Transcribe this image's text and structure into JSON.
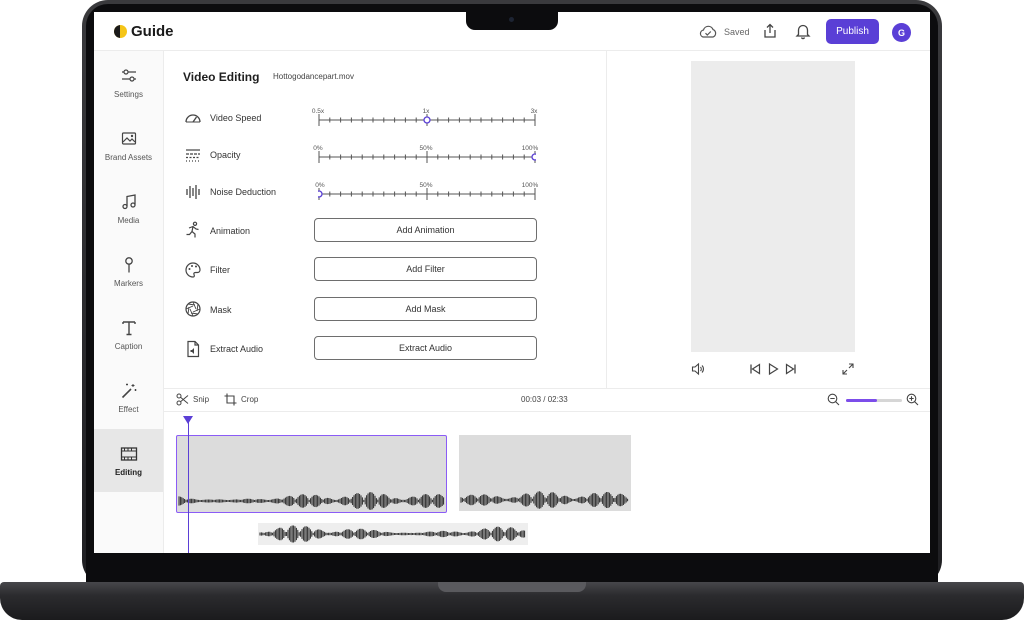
{
  "app": {
    "name": "Guide"
  },
  "header": {
    "saved_label": "Saved",
    "publish_label": "Publish",
    "avatar_initial": "G",
    "accent_color": "#5a3fd6"
  },
  "sidebar": {
    "items": [
      {
        "label": "Settings",
        "icon": "sliders-icon"
      },
      {
        "label": "Brand Assets",
        "icon": "image-icon"
      },
      {
        "label": "Media",
        "icon": "music-note-icon"
      },
      {
        "label": "Markers",
        "icon": "pin-icon"
      },
      {
        "label": "Caption",
        "icon": "text-icon"
      },
      {
        "label": "Effect",
        "icon": "magic-wand-icon"
      },
      {
        "label": "Editing",
        "icon": "film-icon",
        "active": true
      }
    ]
  },
  "panel": {
    "title": "Video Editing",
    "file_name": "Hottogodancepart.mov",
    "sliders": [
      {
        "label": "Video Speed",
        "icon": "speedometer-icon",
        "ticks": [
          "0.5x",
          "1x",
          "3x"
        ],
        "value_fraction": 0.5
      },
      {
        "label": "Opacity",
        "icon": "opacity-lines-icon",
        "ticks": [
          "0%",
          "50%",
          "100%"
        ],
        "value_fraction": 1.0
      },
      {
        "label": "Noise Deduction",
        "icon": "soundwave-icon",
        "ticks": [
          "0%",
          "50%",
          "100%"
        ],
        "value_fraction": 0.0
      }
    ],
    "actions": [
      {
        "label": "Animation",
        "icon": "running-person-icon",
        "button": "Add Animation"
      },
      {
        "label": "Filter",
        "icon": "palette-icon",
        "button": "Add Filter"
      },
      {
        "label": "Mask",
        "icon": "aperture-icon",
        "button": "Add Mask"
      },
      {
        "label": "Extract Audio",
        "icon": "audio-file-icon",
        "button": "Extract Audio"
      }
    ]
  },
  "timeline": {
    "snip_label": "Snip",
    "crop_label": "Crop",
    "timecode": "00:03 / 02:33",
    "zoom_fraction": 0.55
  }
}
